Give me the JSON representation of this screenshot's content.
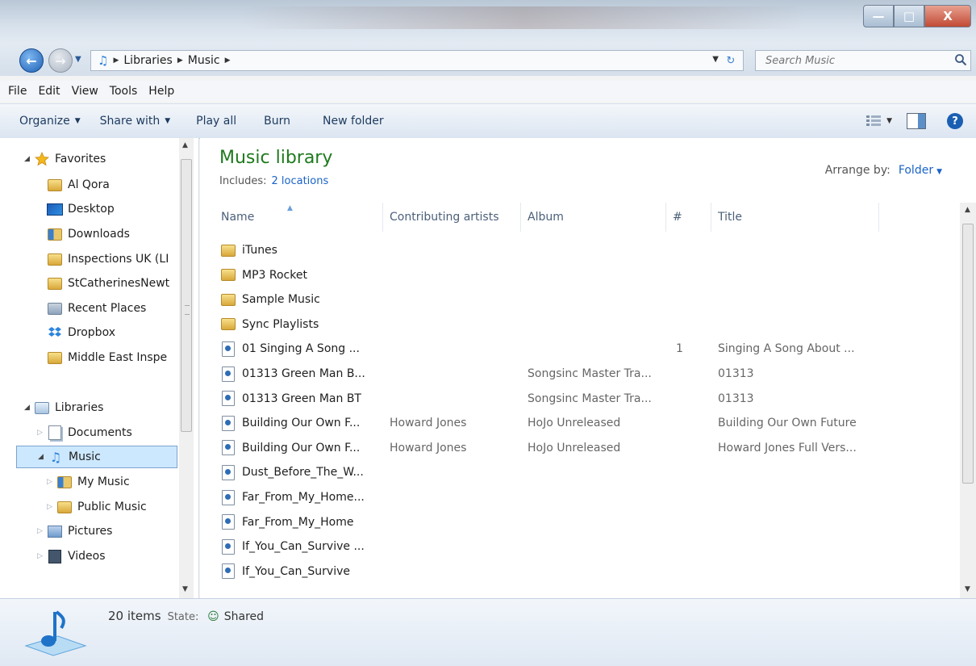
{
  "colors": {
    "library_title": "#1e7a1e",
    "link": "#1a63c6",
    "selected_bg": "#cce8ff"
  },
  "window": {
    "controls": {
      "minimize": "—",
      "maximize": "□",
      "close": "X"
    }
  },
  "address": {
    "breadcrumbs": [
      "Libraries",
      "Music"
    ],
    "search_placeholder": "Search Music"
  },
  "menubar": [
    "File",
    "Edit",
    "View",
    "Tools",
    "Help"
  ],
  "toolbar": {
    "organize": "Organize",
    "share_with": "Share with",
    "play_all": "Play all",
    "burn": "Burn",
    "new_folder": "New folder"
  },
  "nav": {
    "favorites_header": "Favorites",
    "favorites": [
      {
        "label": "Al Qora",
        "icon": "folder-icon"
      },
      {
        "label": "Desktop",
        "icon": "desktop-icon"
      },
      {
        "label": "Downloads",
        "icon": "downloads-folder-icon"
      },
      {
        "label": "Inspections UK (LI",
        "icon": "folder-icon"
      },
      {
        "label": "StCatherinesNewt",
        "icon": "folder-icon"
      },
      {
        "label": "Recent Places",
        "icon": "recent-places-icon"
      },
      {
        "label": "Dropbox",
        "icon": "dropbox-icon"
      },
      {
        "label": "Middle East Inspe",
        "icon": "folder-icon"
      }
    ],
    "libraries_header": "Libraries",
    "documents": "Documents",
    "music": "Music",
    "my_music": "My Music",
    "public_music": "Public Music",
    "pictures": "Pictures",
    "videos": "Videos"
  },
  "content": {
    "title": "Music library",
    "includes_label": "Includes:",
    "includes_link": "2 locations",
    "arrange_label": "Arrange by:",
    "arrange_value": "Folder",
    "columns": [
      "Name",
      "Contributing artists",
      "Album",
      "#",
      "Title"
    ],
    "rows": [
      {
        "name": "iTunes",
        "type": "folder",
        "artist": "",
        "album": "",
        "num": "",
        "title": ""
      },
      {
        "name": "MP3 Rocket",
        "type": "folder",
        "artist": "",
        "album": "",
        "num": "",
        "title": ""
      },
      {
        "name": "Sample Music",
        "type": "folder",
        "artist": "",
        "album": "",
        "num": "",
        "title": ""
      },
      {
        "name": "Sync Playlists",
        "type": "folder",
        "artist": "",
        "album": "",
        "num": "",
        "title": ""
      },
      {
        "name": "01 Singing A Song ...",
        "type": "audio",
        "artist": "",
        "album": "",
        "num": "1",
        "title": "Singing A Song About ..."
      },
      {
        "name": "01313 Green Man B...",
        "type": "audio",
        "artist": "",
        "album": "Songsinc Master Tra...",
        "num": "",
        "title": "01313"
      },
      {
        "name": "01313 Green Man BT",
        "type": "audio",
        "artist": "",
        "album": "Songsinc Master Tra...",
        "num": "",
        "title": "01313"
      },
      {
        "name": "Building Our Own F...",
        "type": "audio",
        "artist": "Howard Jones",
        "album": "HoJo Unreleased",
        "num": "",
        "title": "Building Our Own Future"
      },
      {
        "name": "Building Our Own F...",
        "type": "audio",
        "artist": "Howard Jones",
        "album": "HoJo Unreleased",
        "num": "",
        "title": "Howard Jones Full Vers..."
      },
      {
        "name": "Dust_Before_The_W...",
        "type": "audio",
        "artist": "",
        "album": "",
        "num": "",
        "title": ""
      },
      {
        "name": "Far_From_My_Home...",
        "type": "audio",
        "artist": "",
        "album": "",
        "num": "",
        "title": ""
      },
      {
        "name": "Far_From_My_Home",
        "type": "audio",
        "artist": "",
        "album": "",
        "num": "",
        "title": ""
      },
      {
        "name": "If_You_Can_Survive ...",
        "type": "audio",
        "artist": "",
        "album": "",
        "num": "",
        "title": ""
      },
      {
        "name": "If_You_Can_Survive",
        "type": "audio",
        "artist": "",
        "album": "",
        "num": "",
        "title": ""
      }
    ]
  },
  "status": {
    "item_count": "20 items",
    "state_label": "State:",
    "state_value": "Shared"
  }
}
